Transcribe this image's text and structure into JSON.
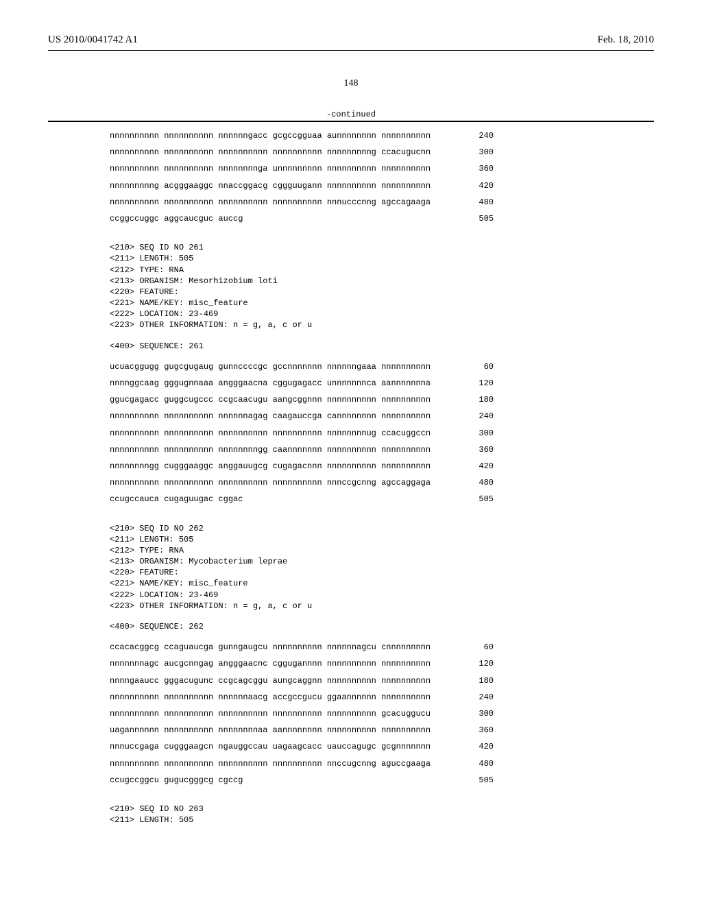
{
  "header": {
    "left": "US 2010/0041742 A1",
    "right": "Feb. 18, 2010"
  },
  "page_number": "148",
  "continued_label": "-continued",
  "blocks": [
    {
      "type": "seq",
      "rows": [
        {
          "seq": "nnnnnnnnnn nnnnnnnnnn nnnnnngacc gcgccgguaa aunnnnnnnn nnnnnnnnnn",
          "pos": "240"
        },
        {
          "seq": "nnnnnnnnnn nnnnnnnnnn nnnnnnnnnn nnnnnnnnnn nnnnnnnnng ccacugucnn",
          "pos": "300"
        },
        {
          "seq": "nnnnnnnnnn nnnnnnnnnn nnnnnnnnga unnnnnnnnn nnnnnnnnnn nnnnnnnnnn",
          "pos": "360"
        },
        {
          "seq": "nnnnnnnnng acgggaaggc nnaccggacg cggguugann nnnnnnnnnn nnnnnnnnnn",
          "pos": "420"
        },
        {
          "seq": "nnnnnnnnnn nnnnnnnnnn nnnnnnnnnn nnnnnnnnnn nnnucccnng agccagaaga",
          "pos": "480"
        },
        {
          "seq": "ccggccuggc aggcaucguc auccg",
          "pos": "505"
        }
      ]
    },
    {
      "type": "meta",
      "lines": [
        "<210> SEQ ID NO 261",
        "<211> LENGTH: 505",
        "<212> TYPE: RNA",
        "<213> ORGANISM: Mesorhizobium loti",
        "<220> FEATURE:",
        "<221> NAME/KEY: misc_feature",
        "<222> LOCATION: 23-469",
        "<223> OTHER INFORMATION: n = g, a, c or u"
      ]
    },
    {
      "type": "meta",
      "lines": [
        "<400> SEQUENCE: 261"
      ]
    },
    {
      "type": "seq",
      "rows": [
        {
          "seq": "ucuacggugg gugcgugaug gunnccccgc gccnnnnnnn nnnnnngaaa nnnnnnnnnn",
          "pos": "60"
        },
        {
          "seq": "nnnnggcaag gggugnnaaa angggaacna cggugagacc unnnnnnnca aannnnnnna",
          "pos": "120"
        },
        {
          "seq": "ggucgagacc guggcugccc ccgcaacugu aangcggnnn nnnnnnnnnn nnnnnnnnnn",
          "pos": "180"
        },
        {
          "seq": "nnnnnnnnnn nnnnnnnnnn nnnnnnagag caagauccga cannnnnnnn nnnnnnnnnn",
          "pos": "240"
        },
        {
          "seq": "nnnnnnnnnn nnnnnnnnnn nnnnnnnnnn nnnnnnnnnn nnnnnnnnug ccacuggccn",
          "pos": "300"
        },
        {
          "seq": "nnnnnnnnnn nnnnnnnnnn nnnnnnnngg caannnnnnn nnnnnnnnnn nnnnnnnnnn",
          "pos": "360"
        },
        {
          "seq": "nnnnnnnngg cugggaaggc anggauugcg cugagacnnn nnnnnnnnnn nnnnnnnnnn",
          "pos": "420"
        },
        {
          "seq": "nnnnnnnnnn nnnnnnnnnn nnnnnnnnnn nnnnnnnnnn nnnccgcnng agccaggaga",
          "pos": "480"
        },
        {
          "seq": "ccugccauca cugaguugac cggac",
          "pos": "505"
        }
      ]
    },
    {
      "type": "meta",
      "lines": [
        "<210> SEQ ID NO 262",
        "<211> LENGTH: 505",
        "<212> TYPE: RNA",
        "<213> ORGANISM: Mycobacterium leprae",
        "<220> FEATURE:",
        "<221> NAME/KEY: misc_feature",
        "<222> LOCATION: 23-469",
        "<223> OTHER INFORMATION: n = g, a, c or u"
      ]
    },
    {
      "type": "meta",
      "lines": [
        "<400> SEQUENCE: 262"
      ]
    },
    {
      "type": "seq",
      "rows": [
        {
          "seq": "ccacacggcg ccaguaucga gunngaugcu nnnnnnnnnn nnnnnnagcu cnnnnnnnnn",
          "pos": "60"
        },
        {
          "seq": "nnnnnnnagc aucgcnngag angggaacnc cggugannnn nnnnnnnnnn nnnnnnnnnn",
          "pos": "120"
        },
        {
          "seq": "nnnngaaucc gggacugunc ccgcagcggu aungcaggnn nnnnnnnnnn nnnnnnnnnn",
          "pos": "180"
        },
        {
          "seq": "nnnnnnnnnn nnnnnnnnnn nnnnnnaacg accgccgucu ggaannnnnn nnnnnnnnnn",
          "pos": "240"
        },
        {
          "seq": "nnnnnnnnnn nnnnnnnnnn nnnnnnnnnn nnnnnnnnnn nnnnnnnnnn gcacuggucu",
          "pos": "300"
        },
        {
          "seq": "uagannnnnn nnnnnnnnnn nnnnnnnnaa aannnnnnnn nnnnnnnnnn nnnnnnnnnn",
          "pos": "360"
        },
        {
          "seq": "nnnuccgaga cugggaagcn ngauggccau uagaagcacc uauccagugc gcgnnnnnnn",
          "pos": "420"
        },
        {
          "seq": "nnnnnnnnnn nnnnnnnnnn nnnnnnnnnn nnnnnnnnnn nnccugcnng aguccgaaga",
          "pos": "480"
        },
        {
          "seq": "ccugccggcu gugucgggcg cgccg",
          "pos": "505"
        }
      ]
    },
    {
      "type": "meta",
      "lines": [
        "<210> SEQ ID NO 263",
        "<211> LENGTH: 505"
      ]
    }
  ]
}
